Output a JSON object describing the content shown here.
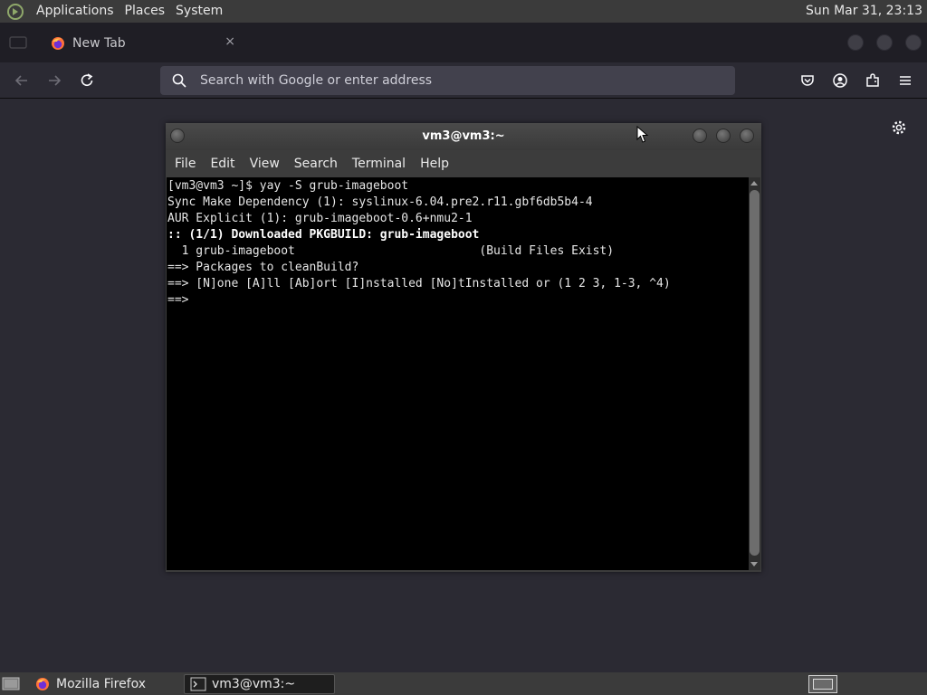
{
  "top_panel": {
    "menus": [
      "Applications",
      "Places",
      "System"
    ],
    "clock": "Sun Mar 31, 23:13"
  },
  "firefox": {
    "tab": {
      "title": "New Tab",
      "close": "×"
    },
    "urlbar": {
      "placeholder": "Search with Google or enter address",
      "value": ""
    }
  },
  "terminal": {
    "title": "vm3@vm3:~",
    "menu": [
      "File",
      "Edit",
      "View",
      "Search",
      "Terminal",
      "Help"
    ],
    "lines": [
      {
        "text": "[vm3@vm3 ~]$ yay -S grub-imageboot",
        "bold": false
      },
      {
        "text": "Sync Make Dependency (1): syslinux-6.04.pre2.r11.gbf6db5b4-4",
        "bold": false
      },
      {
        "text": "AUR Explicit (1): grub-imageboot-0.6+nmu2-1",
        "bold": false
      },
      {
        "text": ":: (1/1) Downloaded PKGBUILD: grub-imageboot",
        "bold": true
      },
      {
        "text": "  1 grub-imageboot                          (Build Files Exist)",
        "bold": false
      },
      {
        "text": "==> Packages to cleanBuild?",
        "bold": false
      },
      {
        "text": "==> [N]one [A]ll [Ab]ort [I]nstalled [No]tInstalled or (1 2 3, 1-3, ^4)",
        "bold": false
      },
      {
        "text": "==> ",
        "bold": false
      }
    ]
  },
  "taskbar": {
    "items": [
      {
        "label": "Mozilla Firefox",
        "icon": "firefox-icon",
        "active": false
      },
      {
        "label": "vm3@vm3:~",
        "icon": "terminal-icon",
        "active": true
      }
    ]
  },
  "colors": {
    "panel": "#3b3b3b",
    "firefox_bg": "#2b2a33",
    "urlbar": "#42414d",
    "terminal_bg": "#000000"
  }
}
